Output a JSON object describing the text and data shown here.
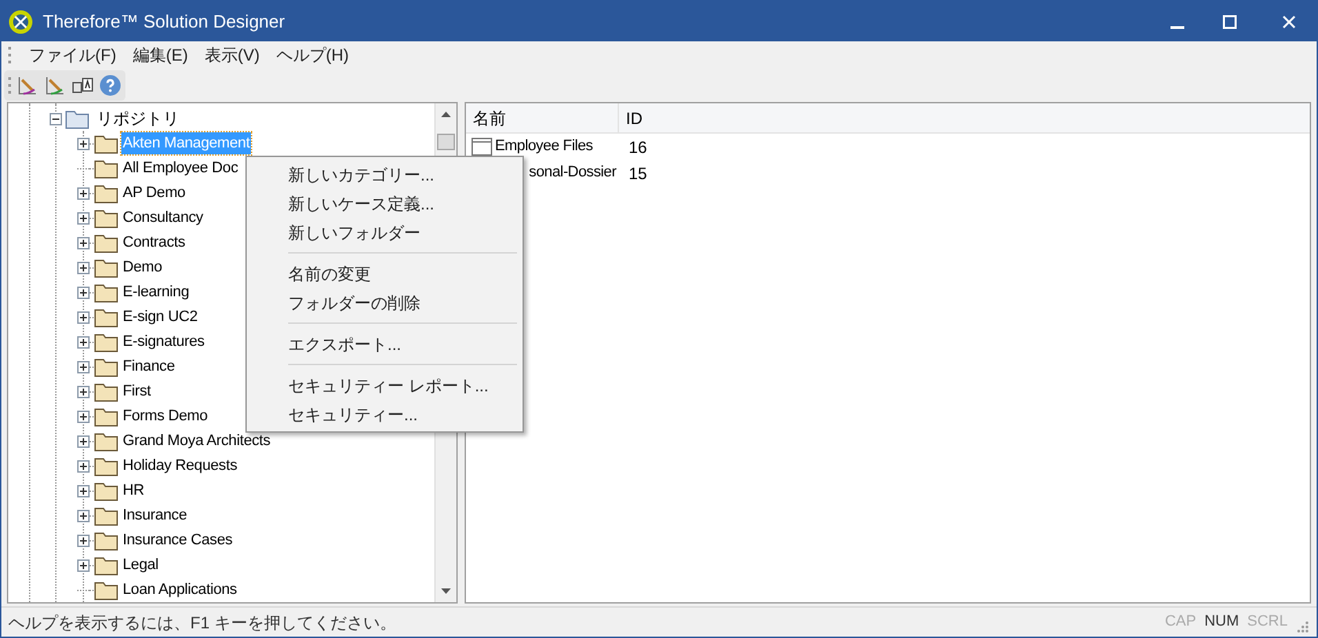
{
  "window": {
    "title": "Therefore™ Solution Designer"
  },
  "menu_bar": [
    "ファイル(F)",
    "編集(E)",
    "表示(V)",
    "ヘルプ(H)"
  ],
  "tree": {
    "label": "リポジトリ",
    "expanded": true,
    "children": [
      {
        "label": "Akten Management",
        "selected": true,
        "has_children": true
      },
      {
        "label": "All Employee Doc",
        "selected": false,
        "has_children": false
      },
      {
        "label": "AP Demo",
        "selected": false,
        "has_children": true
      },
      {
        "label": "Consultancy",
        "selected": false,
        "has_children": true
      },
      {
        "label": "Contracts",
        "selected": false,
        "has_children": true
      },
      {
        "label": "Demo",
        "selected": false,
        "has_children": true
      },
      {
        "label": "E-learning",
        "selected": false,
        "has_children": true
      },
      {
        "label": "E-sign UC2",
        "selected": false,
        "has_children": true
      },
      {
        "label": "E-signatures",
        "selected": false,
        "has_children": true
      },
      {
        "label": "Finance",
        "selected": false,
        "has_children": true
      },
      {
        "label": "First",
        "selected": false,
        "has_children": true
      },
      {
        "label": "Forms Demo",
        "selected": false,
        "has_children": true
      },
      {
        "label": "Grand Moya Architects",
        "selected": false,
        "has_children": true
      },
      {
        "label": "Holiday Requests",
        "selected": false,
        "has_children": true
      },
      {
        "label": "HR",
        "selected": false,
        "has_children": true
      },
      {
        "label": "Insurance",
        "selected": false,
        "has_children": true
      },
      {
        "label": "Insurance Cases",
        "selected": false,
        "has_children": true
      },
      {
        "label": "Legal",
        "selected": false,
        "has_children": true
      },
      {
        "label": "Loan Applications",
        "selected": false,
        "has_children": false
      }
    ]
  },
  "list": {
    "columns": [
      "名前",
      "ID"
    ],
    "rows": [
      {
        "name": "Employee Files",
        "id": "16",
        "covered": false
      },
      {
        "name": "sonal-Dossier",
        "id": "15",
        "covered": true
      }
    ]
  },
  "context_menu": [
    {
      "kind": "item",
      "label": "新しいカテゴリー..."
    },
    {
      "kind": "item",
      "label": "新しいケース定義..."
    },
    {
      "kind": "item",
      "label": "新しいフォルダー"
    },
    {
      "kind": "separator"
    },
    {
      "kind": "item",
      "label": "名前の変更"
    },
    {
      "kind": "item",
      "label": "フォルダーの削除"
    },
    {
      "kind": "separator"
    },
    {
      "kind": "item",
      "label": "エクスポート..."
    },
    {
      "kind": "separator"
    },
    {
      "kind": "item",
      "label": "セキュリティー レポート..."
    },
    {
      "kind": "item",
      "label": "セキュリティー..."
    }
  ],
  "status_bar": {
    "text": "ヘルプを表示するには、F1 キーを押してください。",
    "indicators": [
      {
        "label": "CAP",
        "on": false
      },
      {
        "label": "NUM",
        "on": true
      },
      {
        "label": "SCRL",
        "on": false
      }
    ]
  }
}
